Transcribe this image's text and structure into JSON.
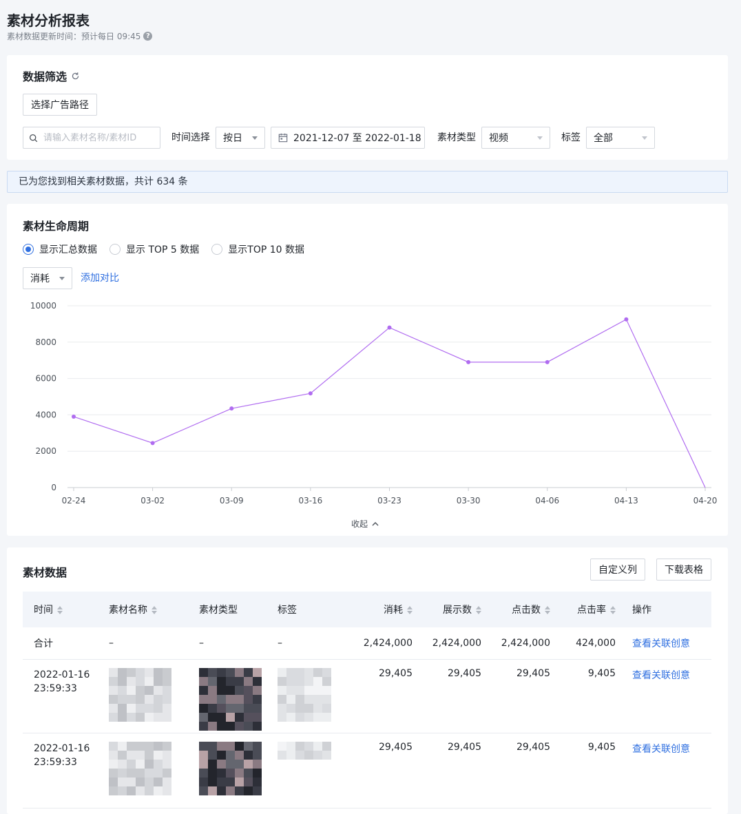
{
  "header": {
    "title": "素材分析报表",
    "subtitle": "素材数据更新时间：预计每日 09:45"
  },
  "filter": {
    "title": "数据筛选",
    "route_button": "选择广告路径",
    "search_placeholder": "请输入素材名称/素材ID",
    "time_label": "时间选择",
    "time_granularity": "按日",
    "date_range": "2021-12-07 至 2022-01-18",
    "type_label": "素材类型",
    "type_value": "视频",
    "tag_label": "标签",
    "tag_value": "全部"
  },
  "info_bar": "已为您找到相关素材数据，共计 634 条",
  "lifecycle": {
    "title": "素材生命周期",
    "radios": [
      "显示汇总数据",
      "显示 TOP 5 数据",
      "显示TOP 10 数据"
    ],
    "selected_radio": 0,
    "metric": "消耗",
    "add_compare": "添加对比",
    "collapse": "收起"
  },
  "chart_data": {
    "type": "line",
    "x": [
      "02-24",
      "03-02",
      "03-09",
      "03-16",
      "03-23",
      "03-30",
      "04-06",
      "04-13",
      "04-20"
    ],
    "values": [
      3900,
      2450,
      4350,
      5180,
      8800,
      6900,
      6900,
      9250,
      0
    ],
    "ylim": [
      0,
      10000
    ],
    "yticks": [
      0,
      2000,
      4000,
      6000,
      8000,
      10000
    ],
    "grid": true,
    "line_color": "#b06cf0"
  },
  "table": {
    "title": "素材数据",
    "custom_columns": "自定义列",
    "download": "下载表格",
    "columns": [
      "时间",
      "素材名称",
      "素材类型",
      "标签",
      "消耗",
      "展示数",
      "点击数",
      "点击率",
      "操作"
    ],
    "summary": {
      "label": "合计",
      "name": "–",
      "type": "–",
      "tag": "–",
      "cost": "2,424,000",
      "impressions": "2,424,000",
      "clicks": "2,424,000",
      "ctr": "424,000",
      "action": "查看关联创意"
    },
    "rows": [
      {
        "date": "2022-01-16",
        "time": "23:59:33",
        "cost": "29,405",
        "impressions": "29,405",
        "clicks": "29,405",
        "ctr": "9,405",
        "action": "查看关联创意"
      },
      {
        "date": "2022-01-16",
        "time": "23:59:33",
        "cost": "29,405",
        "impressions": "29,405",
        "clicks": "29,405",
        "ctr": "9,405",
        "action": "查看关联创意"
      }
    ]
  }
}
